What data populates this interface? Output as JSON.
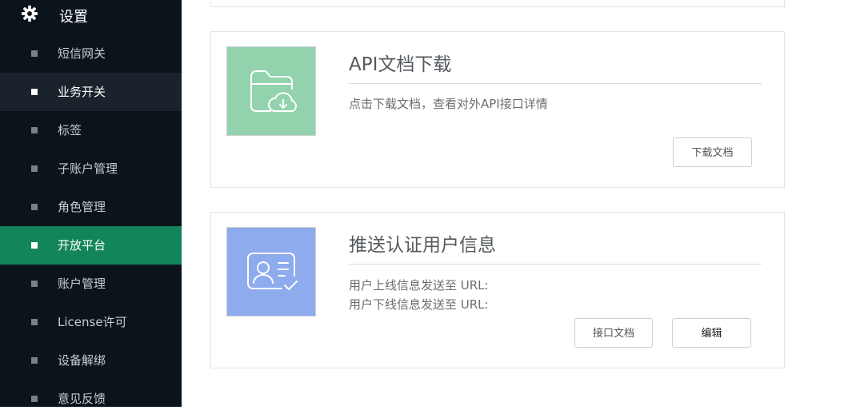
{
  "sidebar": {
    "header": {
      "title": "设置",
      "icon": "gear-icon"
    },
    "items": [
      {
        "label": "短信网关",
        "state": "normal"
      },
      {
        "label": "业务开关",
        "state": "hover"
      },
      {
        "label": "标签",
        "state": "normal"
      },
      {
        "label": "子账户管理",
        "state": "normal"
      },
      {
        "label": "角色管理",
        "state": "normal"
      },
      {
        "label": "开放平台",
        "state": "active"
      },
      {
        "label": "账户管理",
        "state": "normal"
      },
      {
        "label": "License许可",
        "state": "normal"
      },
      {
        "label": "设备解绑",
        "state": "normal"
      },
      {
        "label": "意见反馈",
        "state": "normal"
      }
    ]
  },
  "api_card": {
    "title": "API文档下载",
    "description": "点击下载文档，查看对外API接口详情",
    "download_button": "下载文档",
    "icon": "folder-cloud-download-icon"
  },
  "push_card": {
    "title": "推送认证用户信息",
    "online_line": "用户上线信息发送至 URL:",
    "offline_line": "用户下线信息发送至 URL:",
    "doc_button": "接口文档",
    "edit_button": "编辑",
    "icon": "user-id-card-check-icon"
  },
  "colors": {
    "sidebar_bg": "#0b141b",
    "active_bg": "#12855a",
    "hover_bg": "#1a232b",
    "api_thumb": "#92d3ae",
    "push_thumb": "#8eabee"
  }
}
